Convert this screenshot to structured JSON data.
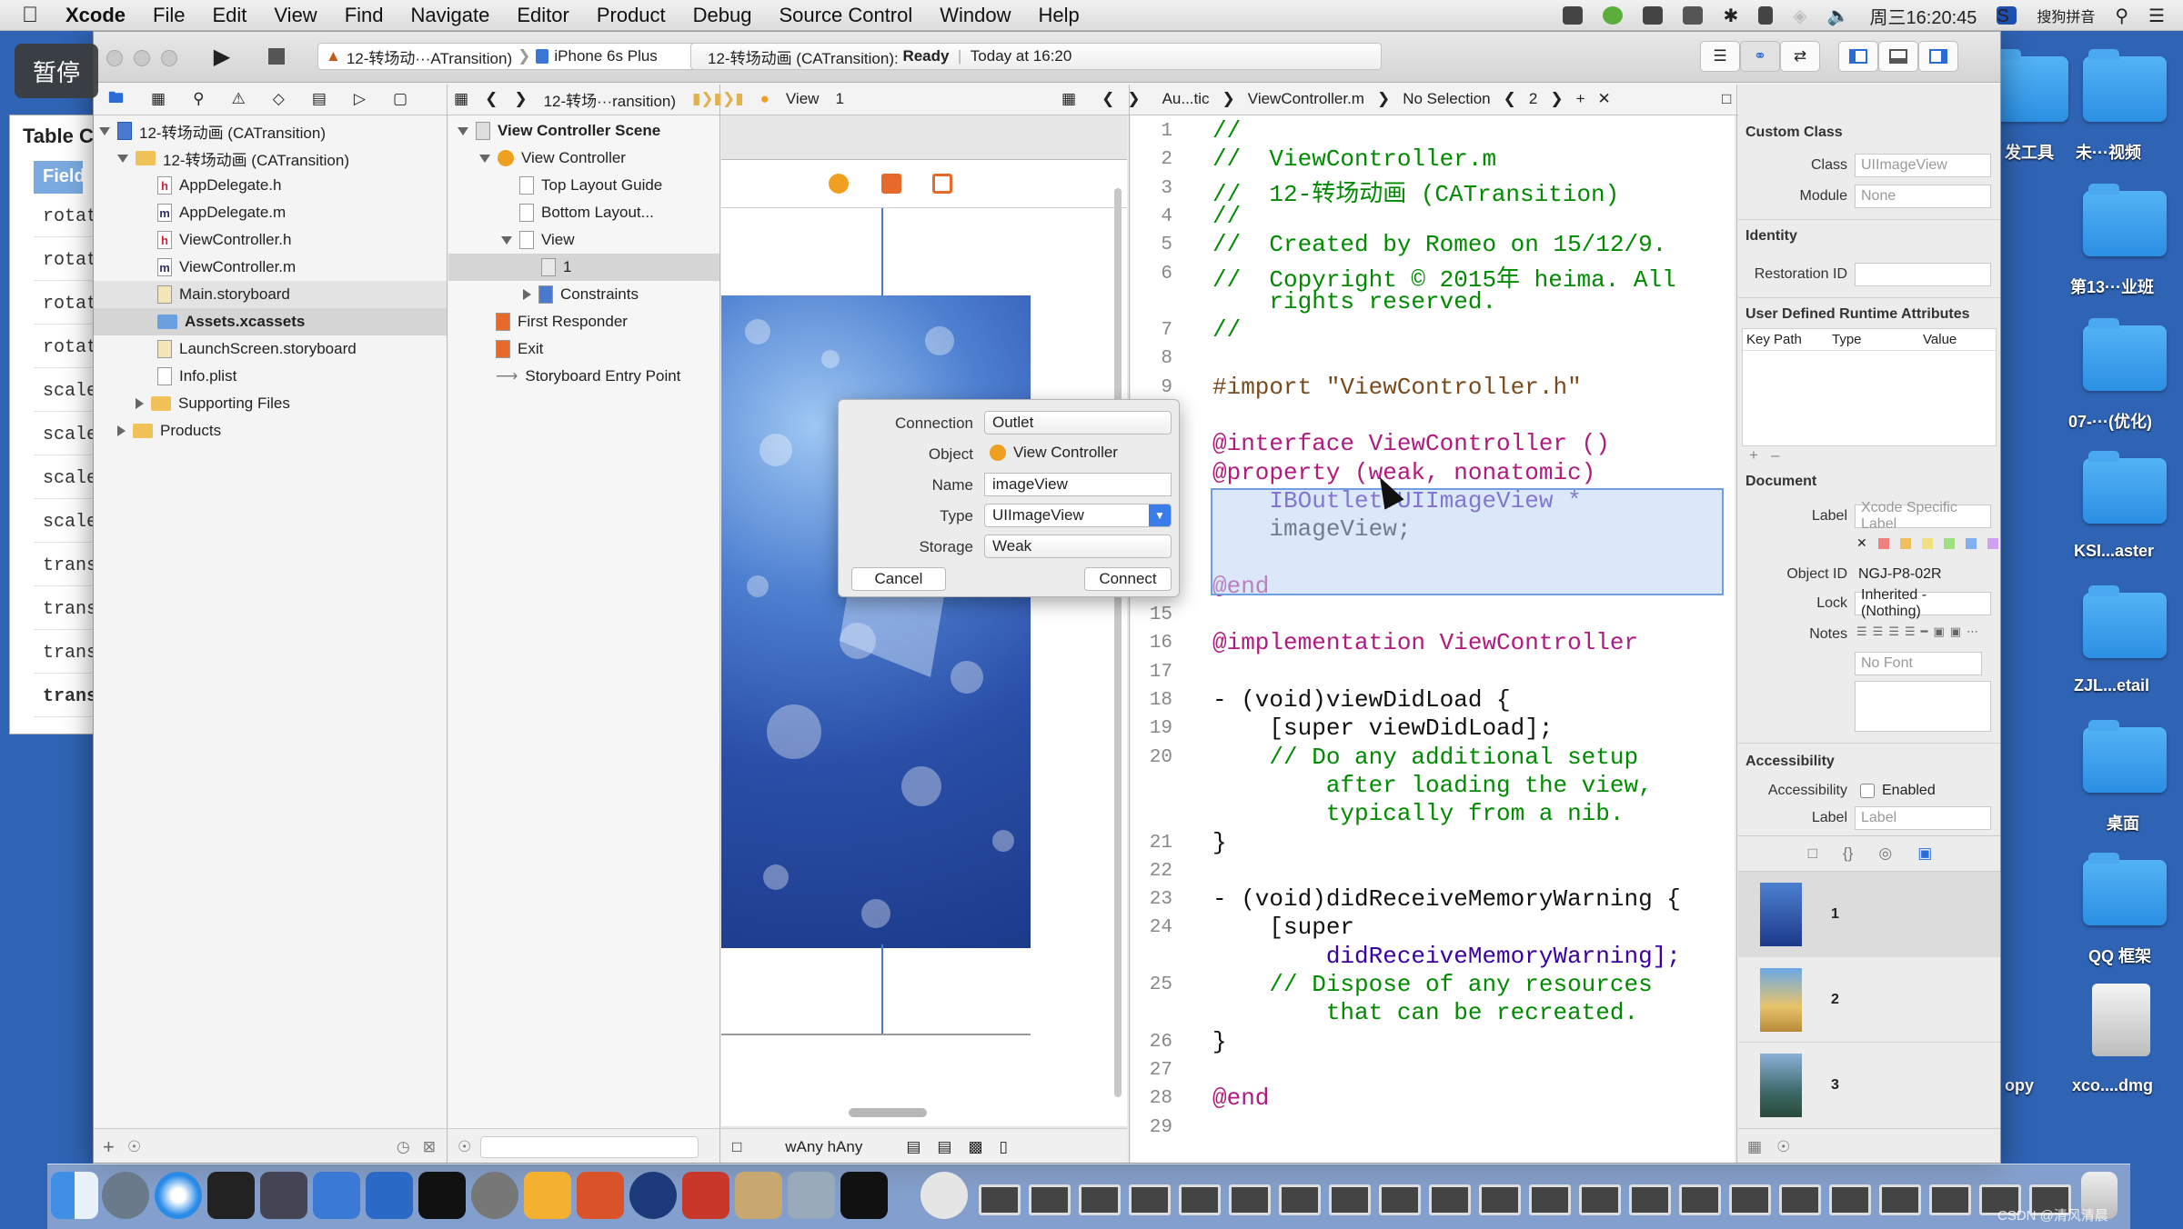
{
  "menubar": {
    "app": "Xcode",
    "items": [
      "File",
      "Edit",
      "View",
      "Find",
      "Navigate",
      "Editor",
      "Product",
      "Debug",
      "Source Control",
      "Window",
      "Help"
    ],
    "clock": "周三16:20:45",
    "ime": "搜狗拼音"
  },
  "overlay": {
    "pause": "暂停"
  },
  "desktop": {
    "labels": [
      "发工具",
      "未···视频",
      "第13···业班",
      "07-···(优化)",
      "KSI...aster",
      "ZJL...etail",
      "桌面",
      "QQ 框架",
      "opy",
      "xco....dmg"
    ],
    "watermark": "CSDN @清风清晨"
  },
  "backwin": {
    "title": "Table C",
    "field": "Field",
    "rows": [
      "rotat",
      "rotat",
      "rotat",
      "rotat",
      "scale",
      "scale",
      "scale",
      "scale",
      "trans",
      "trans",
      "trans",
      "transla"
    ]
  },
  "toolbar": {
    "scheme": "12-转场动···ATransition)",
    "device": "iPhone 6s Plus",
    "status_project": "12-转场动画 (CATransition):",
    "status_state": "Ready",
    "status_time": "Today at 16:20"
  },
  "jumpbar": {
    "crumb1": "12-转场···ransition)",
    "crumb_view": "View",
    "crumb_num": "1",
    "ed_crumb1": "Au...tic",
    "ed_file": "ViewController.m",
    "ed_sel": "No Selection",
    "ed_count": "2"
  },
  "navigator": {
    "items": [
      {
        "label": "12-转场动画 (CATransition)",
        "kind": "proj"
      },
      {
        "label": "12-转场动画 (CATransition)",
        "kind": "folder"
      },
      {
        "label": "AppDelegate.h",
        "kind": "h"
      },
      {
        "label": "AppDelegate.m",
        "kind": "m"
      },
      {
        "label": "ViewController.h",
        "kind": "h"
      },
      {
        "label": "ViewController.m",
        "kind": "m"
      },
      {
        "label": "Main.storyboard",
        "kind": "sb"
      },
      {
        "label": "Assets.xcassets",
        "kind": "as"
      },
      {
        "label": "LaunchScreen.storyboard",
        "kind": "sb"
      },
      {
        "label": "Info.plist",
        "kind": "pl"
      },
      {
        "label": "Supporting Files",
        "kind": "folder"
      },
      {
        "label": "Products",
        "kind": "folder"
      }
    ]
  },
  "outline": {
    "items": [
      "View Controller Scene",
      "View Controller",
      "Top Layout Guide",
      "Bottom Layout...",
      "View",
      "1",
      "Constraints",
      "First Responder",
      "Exit",
      "Storyboard Entry Point"
    ]
  },
  "canvas": {
    "size_w": "wAny",
    "size_h": "hAny"
  },
  "popover": {
    "connection_label": "Connection",
    "connection": "Outlet",
    "object_label": "Object",
    "object": "View Controller",
    "name_label": "Name",
    "name": "imageView",
    "type_label": "Type",
    "type": "UIImageView",
    "storage_label": "Storage",
    "storage": "Weak",
    "cancel": "Cancel",
    "connect": "Connect"
  },
  "editor": {
    "lines": [
      {
        "n": "1",
        "t": "//",
        "c": "cm"
      },
      {
        "n": "2",
        "t": "//  ViewController.m",
        "c": "cm"
      },
      {
        "n": "3",
        "t": "//  12-转场动画 (CATransition)",
        "c": "cm"
      },
      {
        "n": "4",
        "t": "//",
        "c": "cm"
      },
      {
        "n": "5",
        "t": "//  Created by Romeo on 15/12/9.",
        "c": "cm"
      },
      {
        "n": "6",
        "t": "//  Copyright © 2015年 heima. All",
        "c": "cm"
      },
      {
        "n": "",
        "t": "    rights reserved.",
        "c": "cm"
      },
      {
        "n": "7",
        "t": "//",
        "c": "cm"
      },
      {
        "n": "8",
        "t": "",
        "c": ""
      },
      {
        "n": "9",
        "t": "#import \"ViewController.h\"",
        "c": "imp"
      },
      {
        "n": "10",
        "t": "",
        "c": ""
      },
      {
        "n": "11",
        "t": "@interface ViewController ()",
        "c": "iface"
      },
      {
        "n": "12",
        "t": "@property (weak, nonatomic)",
        "c": "prop"
      },
      {
        "n": "",
        "t": "    IBOutlet UIImageView *",
        "c": "prop2"
      },
      {
        "n": "",
        "t": "    imageView;",
        "c": ""
      },
      {
        "n": "13",
        "t": "",
        "c": ""
      },
      {
        "n": "14",
        "t": "@end",
        "c": "kw"
      },
      {
        "n": "15",
        "t": "",
        "c": ""
      },
      {
        "n": "16",
        "t": "@implementation ViewController",
        "c": "impl"
      },
      {
        "n": "17",
        "t": "",
        "c": ""
      },
      {
        "n": "18",
        "t": "- (void)viewDidLoad {",
        "c": "meth"
      },
      {
        "n": "19",
        "t": "    [super viewDidLoad];",
        "c": "sup"
      },
      {
        "n": "20",
        "t": "    // Do any additional setup",
        "c": "cm"
      },
      {
        "n": "",
        "t": "        after loading the view,",
        "c": "cm"
      },
      {
        "n": "",
        "t": "        typically from a nib.",
        "c": "cm"
      },
      {
        "n": "21",
        "t": "}",
        "c": ""
      },
      {
        "n": "22",
        "t": "",
        "c": ""
      },
      {
        "n": "23",
        "t": "- (void)didReceiveMemoryWarning {",
        "c": "meth"
      },
      {
        "n": "24",
        "t": "    [super",
        "c": "sup"
      },
      {
        "n": "",
        "t": "        didReceiveMemoryWarning];",
        "c": "ty"
      },
      {
        "n": "25",
        "t": "    // Dispose of any resources",
        "c": "cm"
      },
      {
        "n": "",
        "t": "        that can be recreated.",
        "c": "cm"
      },
      {
        "n": "26",
        "t": "}",
        "c": ""
      },
      {
        "n": "27",
        "t": "",
        "c": ""
      },
      {
        "n": "28",
        "t": "@end",
        "c": "kw"
      },
      {
        "n": "29",
        "t": "",
        "c": ""
      }
    ]
  },
  "inspector": {
    "custom_class": "Custom Class",
    "class_label": "Class",
    "class_ph": "UIImageView",
    "module_label": "Module",
    "module_ph": "None",
    "identity": "Identity",
    "restoration": "Restoration ID",
    "udra": "User Defined Runtime Attributes",
    "col_key": "Key Path",
    "col_type": "Type",
    "col_value": "Value",
    "document": "Document",
    "label_label": "Label",
    "label_ph": "Xcode Specific Label",
    "objid_label": "Object ID",
    "objid": "NGJ-P8-02R",
    "lock_label": "Lock",
    "lock": "Inherited - (Nothing)",
    "notes_label": "Notes",
    "font_ph": "No Font",
    "accessibility": "Accessibility",
    "acc_label": "Accessibility",
    "acc_enabled": "Enabled",
    "acc_label2": "Label",
    "acc_ph": "Label",
    "lib": [
      "1",
      "2",
      "3"
    ]
  }
}
